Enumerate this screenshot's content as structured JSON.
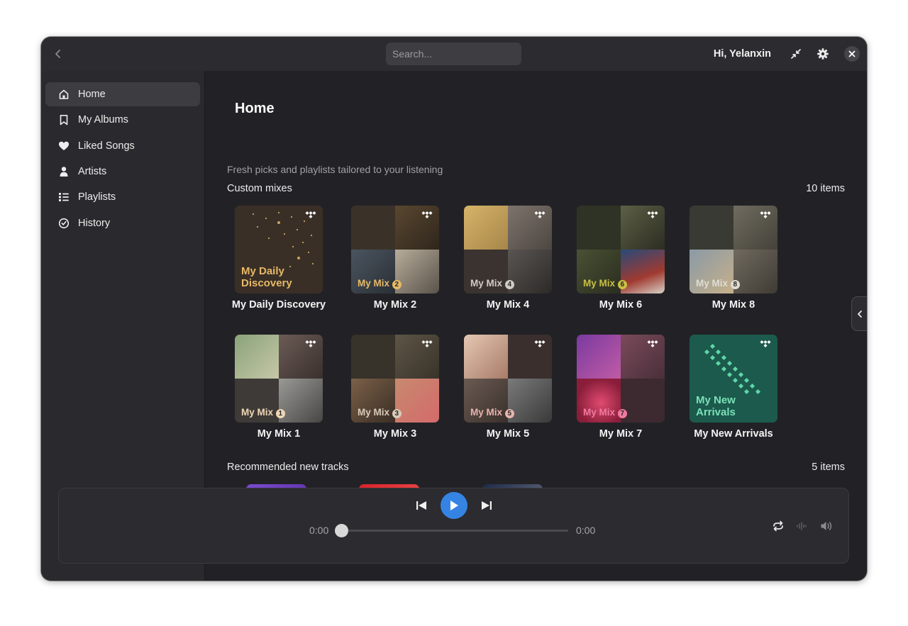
{
  "header": {
    "search_placeholder": "Search...",
    "greeting": "Hi, Yelanxin"
  },
  "sidebar": {
    "items": [
      {
        "label": "Home",
        "icon": "home-icon",
        "active": true
      },
      {
        "label": "My Albums",
        "icon": "bookmark-icon",
        "active": false
      },
      {
        "label": "Liked Songs",
        "icon": "heart-icon",
        "active": false
      },
      {
        "label": "Artists",
        "icon": "person-icon",
        "active": false
      },
      {
        "label": "Playlists",
        "icon": "list-icon",
        "active": false
      },
      {
        "label": "History",
        "icon": "clock-icon",
        "active": false
      }
    ]
  },
  "main": {
    "title": "Home",
    "subtitle": "Fresh picks and playlists tailored to your listening",
    "custom_mixes": {
      "title": "Custom mixes",
      "count": "10 items",
      "cards": [
        {
          "title": "My Daily Discovery",
          "cover_label": "My Daily\nDiscovery"
        },
        {
          "title": "My Mix 2",
          "cover_label": "My Mix",
          "badge": "2"
        },
        {
          "title": "My Mix 4",
          "cover_label": "My Mix",
          "badge": "4"
        },
        {
          "title": "My Mix 6",
          "cover_label": "My Mix",
          "badge": "6"
        },
        {
          "title": "My Mix 8",
          "cover_label": "My Mix",
          "badge": "8"
        },
        {
          "title": "My Mix 1",
          "cover_label": "My Mix",
          "badge": "1"
        },
        {
          "title": "My Mix 3",
          "cover_label": "My Mix",
          "badge": "3"
        },
        {
          "title": "My Mix 5",
          "cover_label": "My Mix",
          "badge": "5"
        },
        {
          "title": "My Mix 7",
          "cover_label": "My Mix",
          "badge": "7"
        },
        {
          "title": "My New Arrivals",
          "cover_label": "My New\nArrivals"
        }
      ]
    },
    "recommended": {
      "title": "Recommended new tracks",
      "count": "5 items"
    }
  },
  "player": {
    "current_time": "0:00",
    "total_time": "0:00",
    "progress": 0
  },
  "colors": {
    "accent": "#3584e4",
    "window_bg": "#222226",
    "sidebar_bg": "#2a2a2e"
  }
}
